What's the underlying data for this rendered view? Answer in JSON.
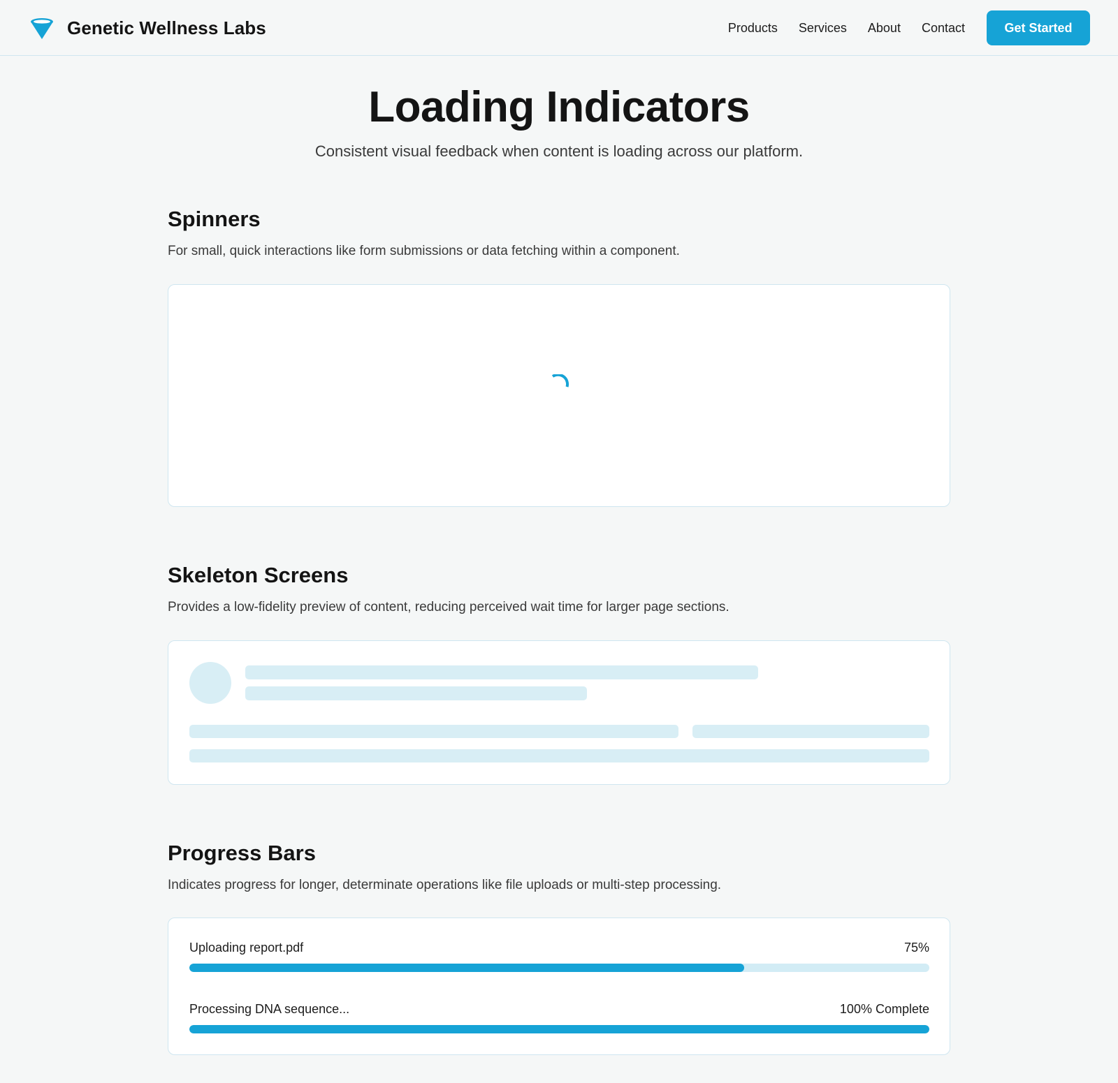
{
  "header": {
    "brand": "Genetic Wellness Labs",
    "logo_icon": "funnel-cone-icon",
    "nav": [
      "Products",
      "Services",
      "About",
      "Contact"
    ],
    "cta": "Get Started"
  },
  "hero": {
    "title": "Loading Indicators",
    "subtitle": "Consistent visual feedback when content is loading across our platform."
  },
  "sections": {
    "spinners": {
      "title": "Spinners",
      "description": "For small, quick interactions like form submissions or data fetching within a component.",
      "spinner_icon": "spinner-arc-icon"
    },
    "skeleton": {
      "title": "Skeleton Screens",
      "description": "Provides a low-fidelity preview of content, reducing perceived wait time for larger page sections."
    },
    "progress": {
      "title": "Progress Bars",
      "description": "Indicates progress for longer, determinate operations like file uploads or multi-step processing.",
      "items": [
        {
          "label": "Uploading report.pdf",
          "value_text": "75%",
          "fraction": 0.75
        },
        {
          "label": "Processing DNA sequence...",
          "value_text": "100% Complete",
          "fraction": 1.0
        }
      ]
    }
  },
  "colors": {
    "accent": "#16a3d6",
    "skeleton": "#d8eef5",
    "track": "#d2ecf5",
    "border": "#cfe6f0",
    "background": "#f5f7f7"
  }
}
